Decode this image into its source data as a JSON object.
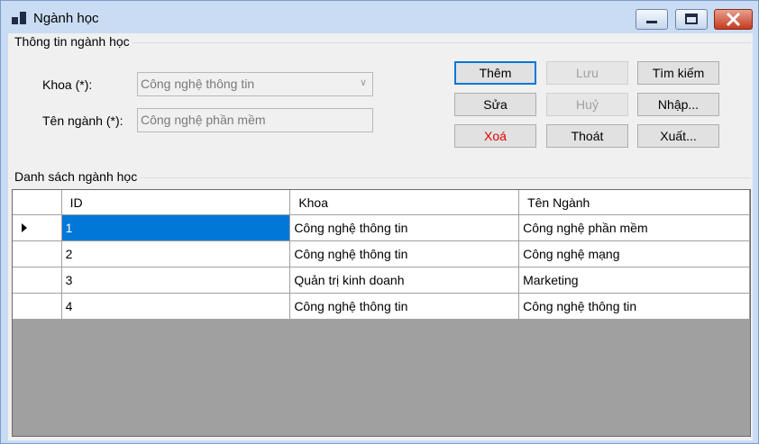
{
  "window": {
    "title": "Ngành học"
  },
  "info_group": {
    "title": "Thông tin ngành học",
    "khoa_label": "Khoa (*):",
    "khoa_value": "Công nghệ thông tin",
    "ten_nganh_label": "Tên ngành (*):",
    "ten_nganh_value": "Công nghệ phần mềm"
  },
  "buttons": {
    "them": "Thêm",
    "luu": "Lưu",
    "tim_kiem": "Tìm kiếm",
    "sua": "Sửa",
    "huy": "Huỷ",
    "nhap": "Nhập...",
    "xoa": "Xoá",
    "thoat": "Thoát",
    "xuat": "Xuất..."
  },
  "list_group": {
    "title": "Danh sách ngành học",
    "columns": [
      "ID",
      "Khoa",
      "Tên Ngành"
    ],
    "rows": [
      [
        "1",
        "Công nghệ thông tin",
        "Công nghệ phần mềm"
      ],
      [
        "2",
        "Công nghệ thông tin",
        "Công nghệ mạng"
      ],
      [
        "3",
        "Quản trị kinh doanh",
        "Marketing"
      ],
      [
        "4",
        "Công nghệ thông tin",
        "Công nghệ thông tin"
      ]
    ]
  },
  "colors": {
    "selection": "#0078d7",
    "danger_text": "#e00000",
    "grid_background": "#a0a0a0"
  }
}
